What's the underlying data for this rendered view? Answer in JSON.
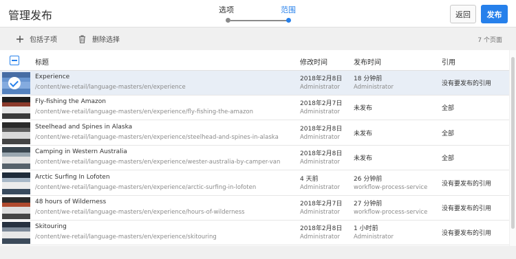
{
  "header": {
    "title": "管理发布",
    "steps": [
      {
        "label": "选项"
      },
      {
        "label": "范围"
      }
    ],
    "back_label": "返回",
    "publish_label": "发布"
  },
  "toolbar": {
    "add_label": "包括子项",
    "delete_label": "删除选择",
    "page_count": "7 个页面"
  },
  "table": {
    "headers": {
      "title": "标题",
      "modified": "修改时间",
      "published": "发布时间",
      "references": "引用"
    },
    "rows": [
      {
        "title": "Experience",
        "path": "/content/we-retail/language-masters/en/experience",
        "mod_date": "2018年2月8日",
        "mod_by": "Administrator",
        "pub_date": "18 分钟前",
        "pub_by": "Administrator",
        "ref": "没有要发布的引用",
        "selected": true
      },
      {
        "title": "Fly-fishing the Amazon",
        "path": "/content/we-retail/language-masters/en/experience/fly-fishing-the-amazon",
        "mod_date": "2018年2月7日",
        "mod_by": "Administrator",
        "pub_date": "未发布",
        "pub_by": "",
        "ref": "全部",
        "selected": false
      },
      {
        "title": "Steelhead and Spines in Alaska",
        "path": "/content/we-retail/language-masters/en/experience/steelhead-and-spines-in-alaska",
        "mod_date": "2018年2月8日",
        "mod_by": "Administrator",
        "pub_date": "未发布",
        "pub_by": "",
        "ref": "全部",
        "selected": false
      },
      {
        "title": "Camping in Western Australia",
        "path": "/content/we-retail/language-masters/en/experience/wester-australia-by-camper-van",
        "mod_date": "2018年2月8日",
        "mod_by": "Administrator",
        "pub_date": "未发布",
        "pub_by": "",
        "ref": "全部",
        "selected": false
      },
      {
        "title": "Arctic Surfing In Lofoten",
        "path": "/content/we-retail/language-masters/en/experience/arctic-surfing-in-lofoten",
        "mod_date": "4 天前",
        "mod_by": "Administrator",
        "pub_date": "26 分钟前",
        "pub_by": "workflow-process-service",
        "ref": "没有要发布的引用",
        "selected": false
      },
      {
        "title": "48 hours of Wilderness",
        "path": "/content/we-retail/language-masters/en/experience/hours-of-wilderness",
        "mod_date": "2018年2月7日",
        "mod_by": "Administrator",
        "pub_date": "27 分钟前",
        "pub_by": "workflow-process-service",
        "ref": "没有要发布的引用",
        "selected": false
      },
      {
        "title": "Skitouring",
        "path": "/content/we-retail/language-masters/en/experience/skitouring",
        "mod_date": "2018年2月8日",
        "mod_by": "Administrator",
        "pub_date": "1 小时前",
        "pub_by": "Administrator",
        "ref": "没有要发布的引用",
        "selected": false
      }
    ]
  },
  "colors": {
    "accent": "#2680eb",
    "selected_row": "#e8eef6"
  }
}
